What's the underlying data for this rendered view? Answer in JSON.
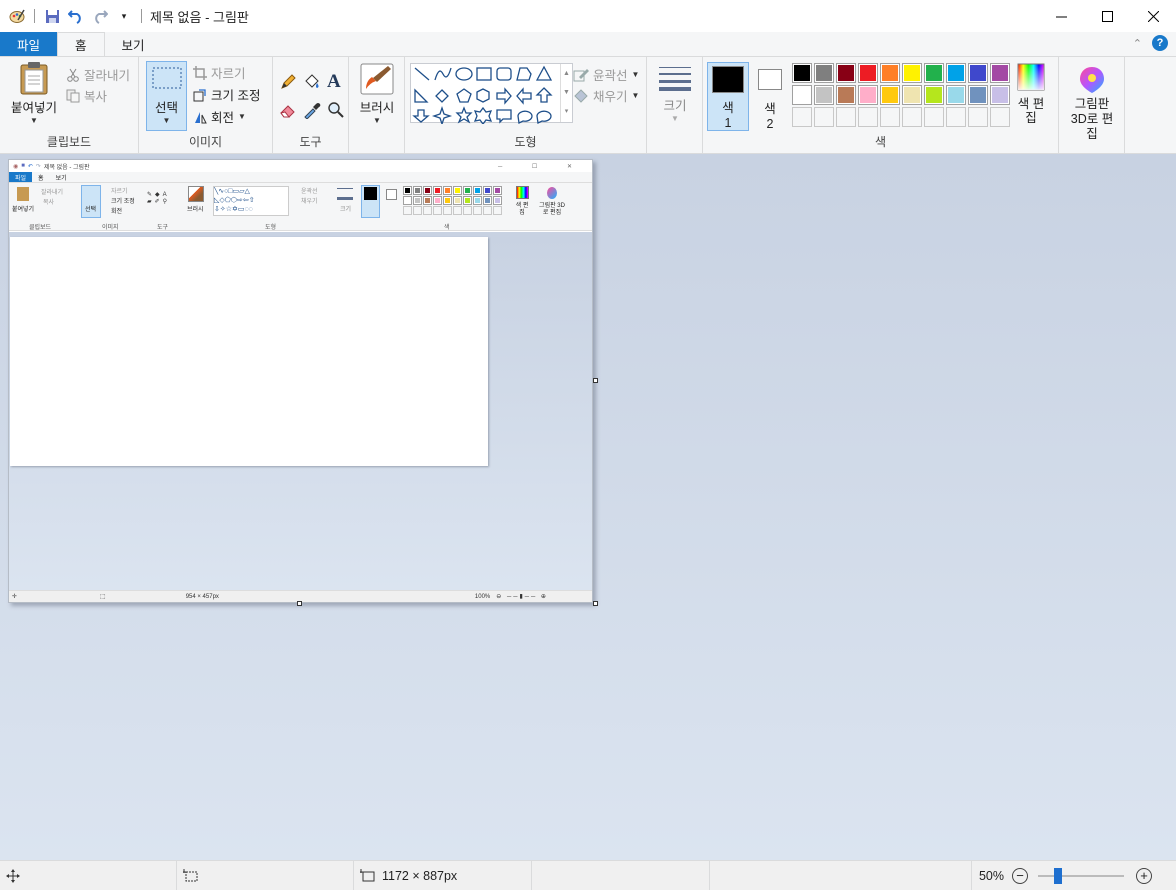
{
  "window": {
    "title": "제목 없음 - 그림판"
  },
  "tabs": {
    "file": "파일",
    "home": "홈",
    "view": "보기"
  },
  "clipboard": {
    "paste": "붙여넣기",
    "cut": "잘라내기",
    "copy": "복사",
    "label": "클립보드"
  },
  "image": {
    "select": "선택",
    "crop": "자르기",
    "resize": "크기 조정",
    "rotate": "회전",
    "label": "이미지"
  },
  "tools": {
    "label": "도구"
  },
  "brush": {
    "label": "브러시"
  },
  "shapes": {
    "outline": "윤곽선",
    "fill": "채우기",
    "label": "도형"
  },
  "size": {
    "label": "크기"
  },
  "colors": {
    "color1": "색",
    "color1_num": "1",
    "color2": "색",
    "color2_num": "2",
    "edit": "색 편집",
    "label": "색",
    "palette_row1": [
      "#000000",
      "#7f7f7f",
      "#880015",
      "#ed1c24",
      "#ff7f27",
      "#fff200",
      "#22b14c",
      "#00a2e8",
      "#3f48cc",
      "#a349a4"
    ],
    "palette_row2": [
      "#ffffff",
      "#c3c3c3",
      "#b97a57",
      "#ffaec9",
      "#ffc90e",
      "#efe4b0",
      "#b5e61d",
      "#99d9ea",
      "#7092be",
      "#c8bfe7"
    ],
    "selected_color1": "#000000",
    "selected_color2": "#ffffff"
  },
  "paint3d": {
    "label": "그림판 3D로 편집"
  },
  "statusbar": {
    "dimensions": "1172 × 887px",
    "zoom": "50%"
  },
  "mini": {
    "title": "제목 없음 - 그림판",
    "dimensions": "954 × 457px",
    "zoom": "100%"
  }
}
